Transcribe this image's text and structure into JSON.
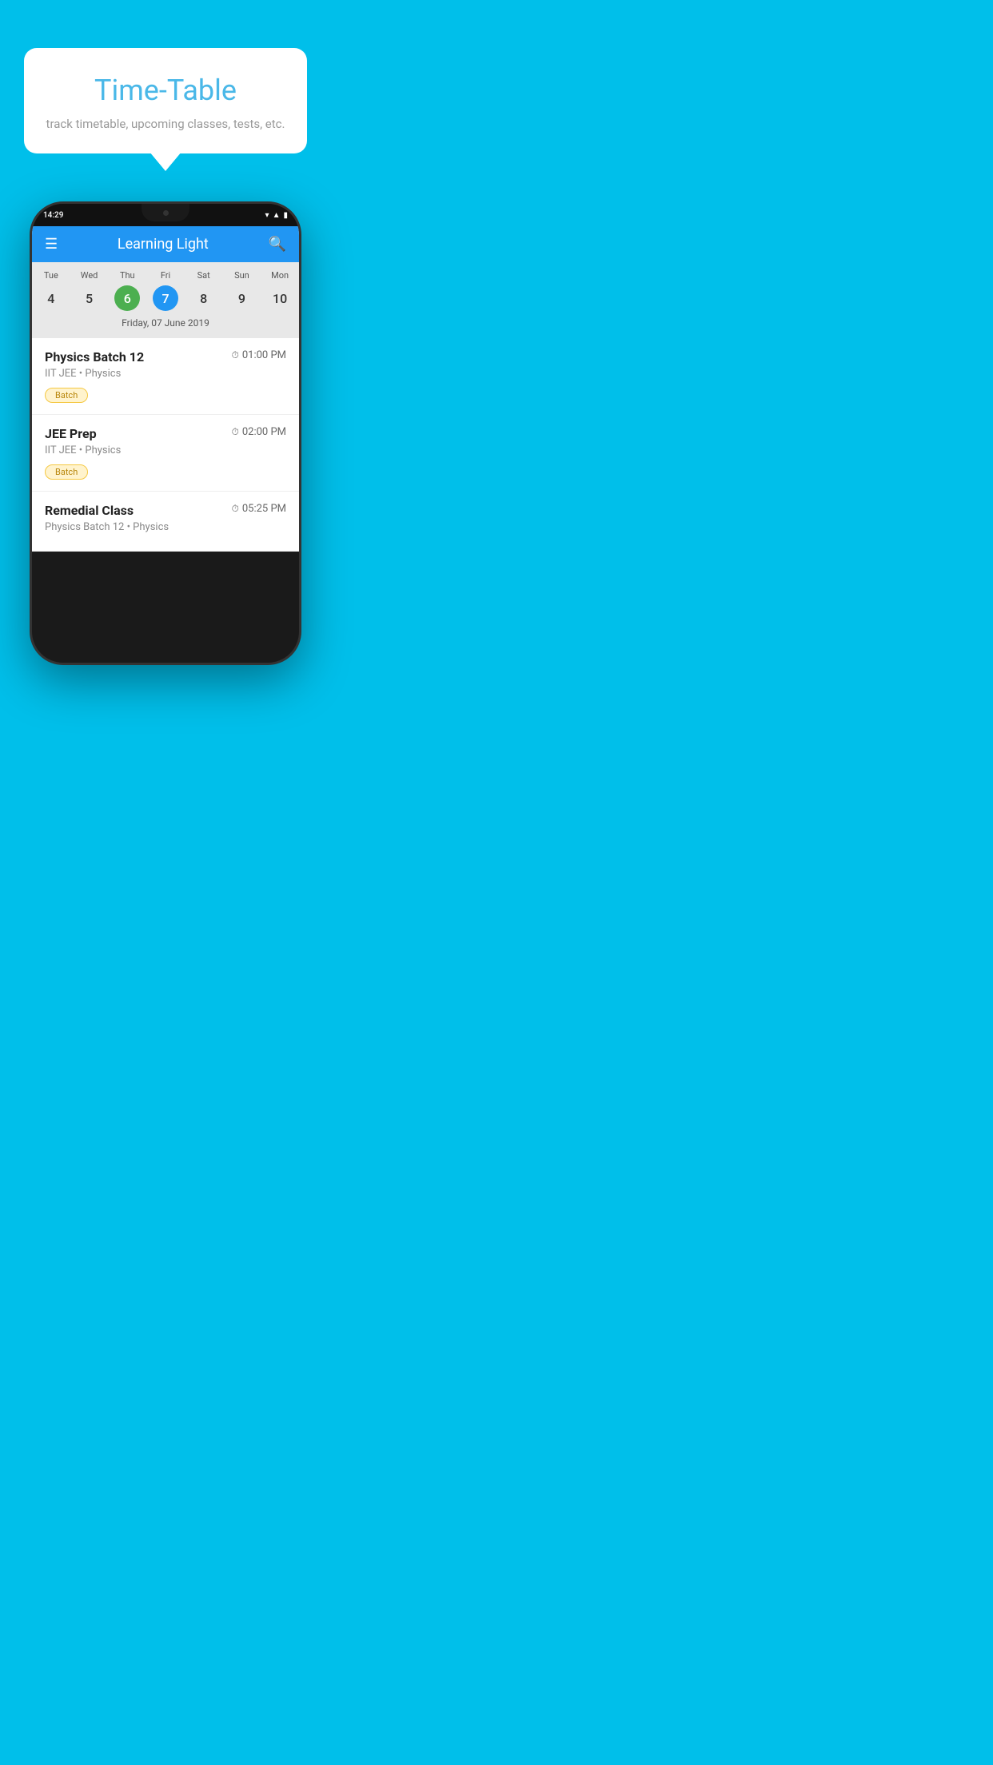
{
  "background": "#00BFEA",
  "tooltip": {
    "title": "Time-Table",
    "subtitle": "track timetable, upcoming classes, tests, etc."
  },
  "phone": {
    "status": {
      "time": "14:29"
    },
    "appBar": {
      "title": "Learning Light",
      "menuIcon": "☰",
      "searchIcon": "🔍"
    },
    "calendar": {
      "days": [
        "Tue",
        "Wed",
        "Thu",
        "Fri",
        "Sat",
        "Sun",
        "Mon"
      ],
      "dates": [
        "4",
        "5",
        "6",
        "7",
        "8",
        "9",
        "10"
      ],
      "todayIndex": 2,
      "selectedIndex": 3,
      "selectedDateLabel": "Friday, 07 June 2019"
    },
    "schedule": [
      {
        "title": "Physics Batch 12",
        "time": "01:00 PM",
        "subtitle": "IIT JEE • Physics",
        "badge": "Batch"
      },
      {
        "title": "JEE Prep",
        "time": "02:00 PM",
        "subtitle": "IIT JEE • Physics",
        "badge": "Batch"
      },
      {
        "title": "Remedial Class",
        "time": "05:25 PM",
        "subtitle": "Physics Batch 12 • Physics",
        "badge": null
      }
    ]
  }
}
